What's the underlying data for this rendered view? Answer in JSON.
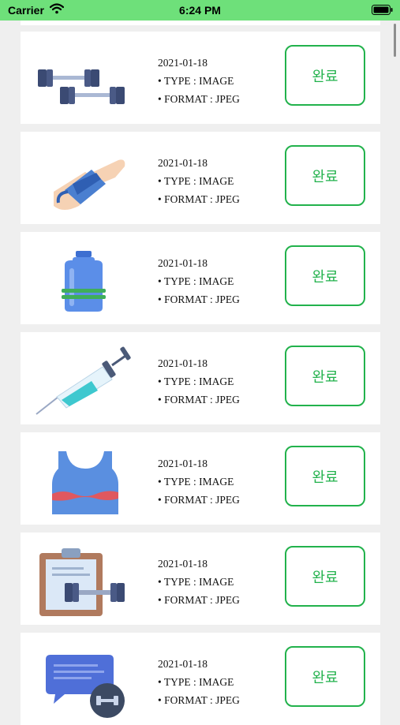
{
  "status_bar": {
    "carrier": "Carrier",
    "time": "6:24 PM",
    "background": "#6ee07a"
  },
  "items": [
    {
      "date": "2021-01-18",
      "type": "• TYPE : IMAGE",
      "format": "• FORMAT : JPEG",
      "button": "완료",
      "icon": "dumbbells-icon"
    },
    {
      "date": "2021-01-18",
      "type": "• TYPE : IMAGE",
      "format": "• FORMAT : JPEG",
      "button": "완료",
      "icon": "wrist-wrap-icon"
    },
    {
      "date": "2021-01-18",
      "type": "• TYPE : IMAGE",
      "format": "• FORMAT : JPEG",
      "button": "완료",
      "icon": "water-bottle-icon"
    },
    {
      "date": "2021-01-18",
      "type": "• TYPE : IMAGE",
      "format": "• FORMAT : JPEG",
      "button": "완료",
      "icon": "syringe-icon"
    },
    {
      "date": "2021-01-18",
      "type": "• TYPE : IMAGE",
      "format": "• FORMAT : JPEG",
      "button": "완료",
      "icon": "tank-top-icon"
    },
    {
      "date": "2021-01-18",
      "type": "• TYPE : IMAGE",
      "format": "• FORMAT : JPEG",
      "button": "완료",
      "icon": "clipboard-dumbbell-icon"
    },
    {
      "date": "2021-01-18",
      "type": "• TYPE : IMAGE",
      "format": "• FORMAT : JPEG",
      "button": "완료",
      "icon": "chat-bubble-icon"
    }
  ],
  "colors": {
    "accent": "#22b24c",
    "card": "#ffffff",
    "background": "#efefef"
  }
}
